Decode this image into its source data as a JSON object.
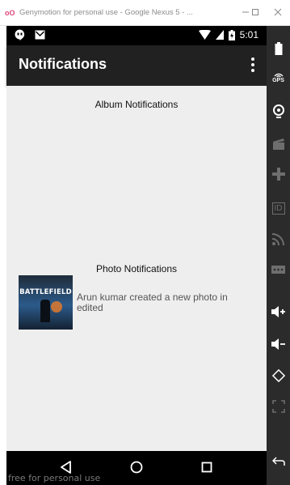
{
  "window": {
    "title": "Genymotion for personal use - Google Nexus 5 - ...",
    "logo": "oO"
  },
  "statusbar": {
    "time": "5:01"
  },
  "appbar": {
    "title": "Notifications"
  },
  "content": {
    "album_section_title": "Album Notifications",
    "photo_section_title": "Photo Notifications",
    "photo_notifications": [
      {
        "thumbnail_text": "BATTLEFIELD",
        "text": "Arun kumar created a new photo in edited"
      }
    ]
  },
  "sidebar": {
    "gps_label": "GPS",
    "id_label": "ID"
  },
  "watermark": "free for personal use",
  "colors": {
    "appbar": "#212121",
    "content_bg": "#eeeeee",
    "sidebar_bg": "#2b2b2b"
  }
}
